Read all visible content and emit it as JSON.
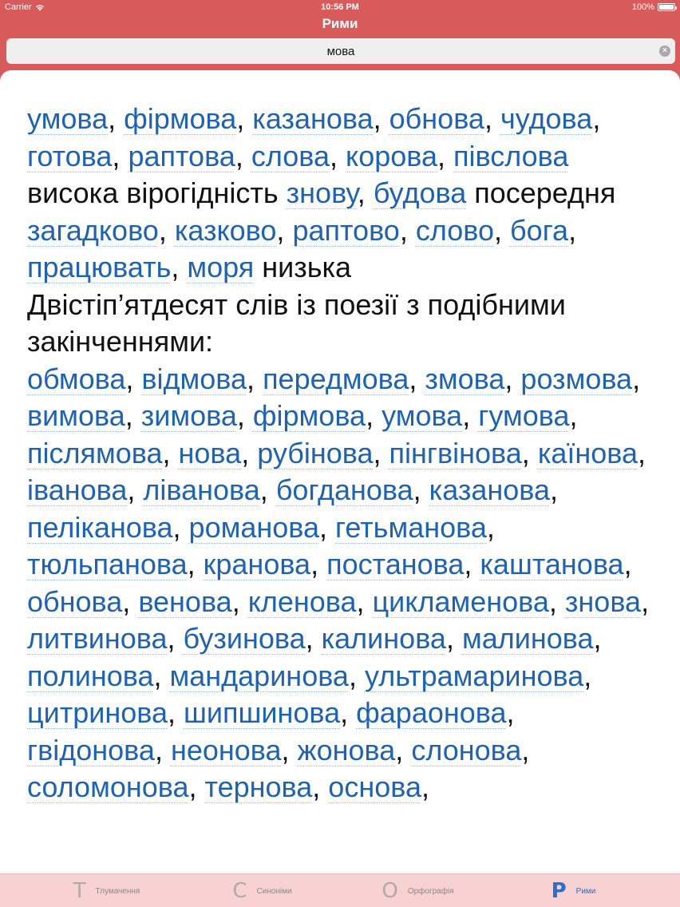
{
  "status": {
    "carrier": "Carrier",
    "time": "10:56 PM",
    "battery": "100%"
  },
  "nav": {
    "title": "Рими"
  },
  "search": {
    "value": "мова"
  },
  "content": {
    "p1": [
      {
        "t": "умова",
        "link": true
      },
      {
        "t": ", "
      },
      {
        "t": "фірмова",
        "link": true
      },
      {
        "t": ", "
      },
      {
        "t": "казанова",
        "link": true
      },
      {
        "t": ", "
      },
      {
        "t": "обнова",
        "link": true
      },
      {
        "t": ", "
      },
      {
        "t": "чудова",
        "link": true
      },
      {
        "t": ", "
      },
      {
        "t": "готова",
        "link": true
      },
      {
        "t": ", "
      },
      {
        "t": "раптова",
        "link": true
      },
      {
        "t": ", "
      },
      {
        "t": "слова",
        "link": true
      },
      {
        "t": ", "
      },
      {
        "t": "корова",
        "link": true
      },
      {
        "t": ", "
      },
      {
        "t": "півслова",
        "link": true
      },
      {
        "t": " висока вірогідність "
      },
      {
        "t": "знову",
        "link": true
      },
      {
        "t": ", "
      },
      {
        "t": "будова",
        "link": true
      },
      {
        "t": " посередня "
      },
      {
        "t": "загадково",
        "link": true
      },
      {
        "t": ", "
      },
      {
        "t": "казково",
        "link": true
      },
      {
        "t": ", "
      },
      {
        "t": "раптово",
        "link": true
      },
      {
        "t": ", "
      },
      {
        "t": "слово",
        "link": true
      },
      {
        "t": ", "
      },
      {
        "t": "бога",
        "link": true
      },
      {
        "t": ", "
      },
      {
        "t": "працювать",
        "link": true
      },
      {
        "t": ", "
      },
      {
        "t": "моря",
        "link": true
      },
      {
        "t": " низька"
      }
    ],
    "heading": "Двістіп’ятдесят слів із поезії з подібними закінченнями:",
    "p2": [
      {
        "t": "обмова",
        "link": true
      },
      {
        "t": ", "
      },
      {
        "t": "відмова",
        "link": true
      },
      {
        "t": ", "
      },
      {
        "t": "передмова",
        "link": true
      },
      {
        "t": ", "
      },
      {
        "t": "змова",
        "link": true
      },
      {
        "t": ", "
      },
      {
        "t": "розмова",
        "link": true
      },
      {
        "t": ", "
      },
      {
        "t": "вимова",
        "link": true
      },
      {
        "t": ", "
      },
      {
        "t": "зимова",
        "link": true
      },
      {
        "t": ", "
      },
      {
        "t": "фірмова",
        "link": true
      },
      {
        "t": ", "
      },
      {
        "t": "умова",
        "link": true
      },
      {
        "t": ", "
      },
      {
        "t": "гумова",
        "link": true
      },
      {
        "t": ", "
      },
      {
        "t": "післямова",
        "link": true
      },
      {
        "t": ", "
      },
      {
        "t": "нова",
        "link": true
      },
      {
        "t": ", "
      },
      {
        "t": "рубінова",
        "link": true
      },
      {
        "t": ", "
      },
      {
        "t": "пінгвінова",
        "link": true
      },
      {
        "t": ", "
      },
      {
        "t": "каїнова",
        "link": true
      },
      {
        "t": ", "
      },
      {
        "t": "іванова",
        "link": true
      },
      {
        "t": ", "
      },
      {
        "t": "ліванова",
        "link": true
      },
      {
        "t": ", "
      },
      {
        "t": "богданова",
        "link": true
      },
      {
        "t": ", "
      },
      {
        "t": "казанова",
        "link": true
      },
      {
        "t": ", "
      },
      {
        "t": "пеліканова",
        "link": true
      },
      {
        "t": ", "
      },
      {
        "t": "романова",
        "link": true
      },
      {
        "t": ", "
      },
      {
        "t": "гетьманова",
        "link": true
      },
      {
        "t": ", "
      },
      {
        "t": "тюльпанова",
        "link": true
      },
      {
        "t": ", "
      },
      {
        "t": "кранова",
        "link": true
      },
      {
        "t": ", "
      },
      {
        "t": "постанова",
        "link": true
      },
      {
        "t": ", "
      },
      {
        "t": "каштанова",
        "link": true
      },
      {
        "t": ", "
      },
      {
        "t": "обнова",
        "link": true
      },
      {
        "t": ", "
      },
      {
        "t": "венова",
        "link": true
      },
      {
        "t": ", "
      },
      {
        "t": "кленова",
        "link": true
      },
      {
        "t": ", "
      },
      {
        "t": "цикламенова",
        "link": true
      },
      {
        "t": ", "
      },
      {
        "t": "знова",
        "link": true
      },
      {
        "t": ", "
      },
      {
        "t": "литвинова",
        "link": true
      },
      {
        "t": ", "
      },
      {
        "t": "бузинова",
        "link": true
      },
      {
        "t": ", "
      },
      {
        "t": "калинова",
        "link": true
      },
      {
        "t": ", "
      },
      {
        "t": "малинова",
        "link": true
      },
      {
        "t": ", "
      },
      {
        "t": "полинова",
        "link": true
      },
      {
        "t": ", "
      },
      {
        "t": "мандаринова",
        "link": true
      },
      {
        "t": ", "
      },
      {
        "t": "ультрамаринова",
        "link": true
      },
      {
        "t": ", "
      },
      {
        "t": "цитринова",
        "link": true
      },
      {
        "t": ", "
      },
      {
        "t": "шипшинова",
        "link": true
      },
      {
        "t": ", "
      },
      {
        "t": "фараонова",
        "link": true
      },
      {
        "t": ", "
      },
      {
        "t": "гвідонова",
        "link": true
      },
      {
        "t": ", "
      },
      {
        "t": "неонова",
        "link": true
      },
      {
        "t": ", "
      },
      {
        "t": "жонова",
        "link": true
      },
      {
        "t": ", "
      },
      {
        "t": "слонова",
        "link": true
      },
      {
        "t": ", "
      },
      {
        "t": "соломонова",
        "link": true
      },
      {
        "t": ", "
      },
      {
        "t": "тернова",
        "link": true
      },
      {
        "t": ", "
      },
      {
        "t": "основа",
        "link": true
      },
      {
        "t": ","
      }
    ]
  },
  "tabs": [
    {
      "icon": "Т",
      "label": "Тлумачення",
      "active": false,
      "name": "tab-definitions"
    },
    {
      "icon": "С",
      "label": "Синоніми",
      "active": false,
      "name": "tab-synonyms"
    },
    {
      "icon": "О",
      "label": "Орфографія",
      "active": false,
      "name": "tab-spelling"
    },
    {
      "icon": "Р",
      "label": "Рими",
      "active": true,
      "name": "tab-rhymes"
    }
  ]
}
